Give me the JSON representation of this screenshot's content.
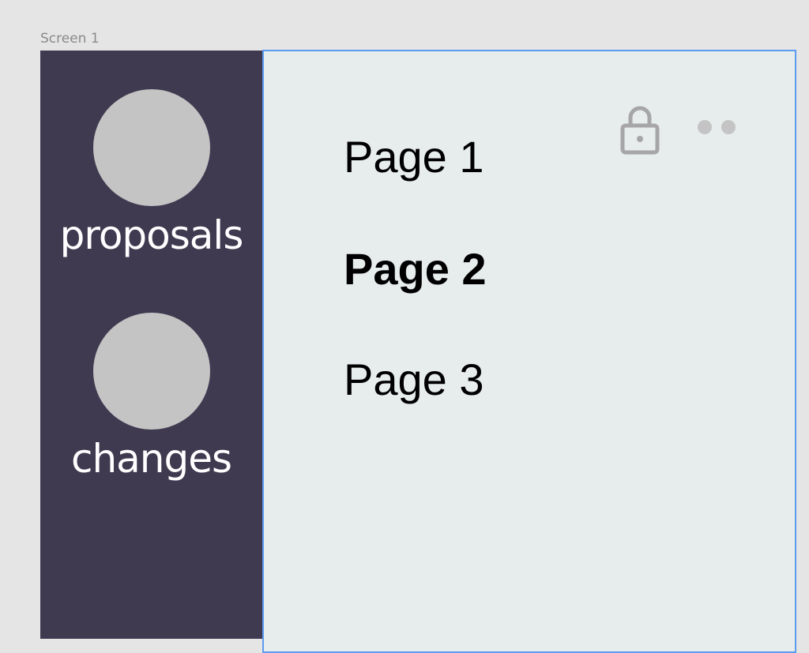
{
  "frame": {
    "label": "Screen 1"
  },
  "sidebar": {
    "items": [
      {
        "label": "proposals",
        "icon": "avatar-circle"
      },
      {
        "label": "changes",
        "icon": "avatar-circle"
      }
    ]
  },
  "panel": {
    "pages": [
      {
        "label": "Page 1",
        "selected": false
      },
      {
        "label": "Page 2",
        "selected": true
      },
      {
        "label": "Page 3",
        "selected": false
      }
    ],
    "icons": {
      "lock": "lock-icon",
      "more": "more-icon"
    }
  },
  "colors": {
    "sidebar_bg": "#403a51",
    "panel_bg": "#e7eced",
    "selection_border": "#5b9cf0",
    "avatar": "#c4c4c4",
    "icon_gray": "#a6a6a6"
  }
}
